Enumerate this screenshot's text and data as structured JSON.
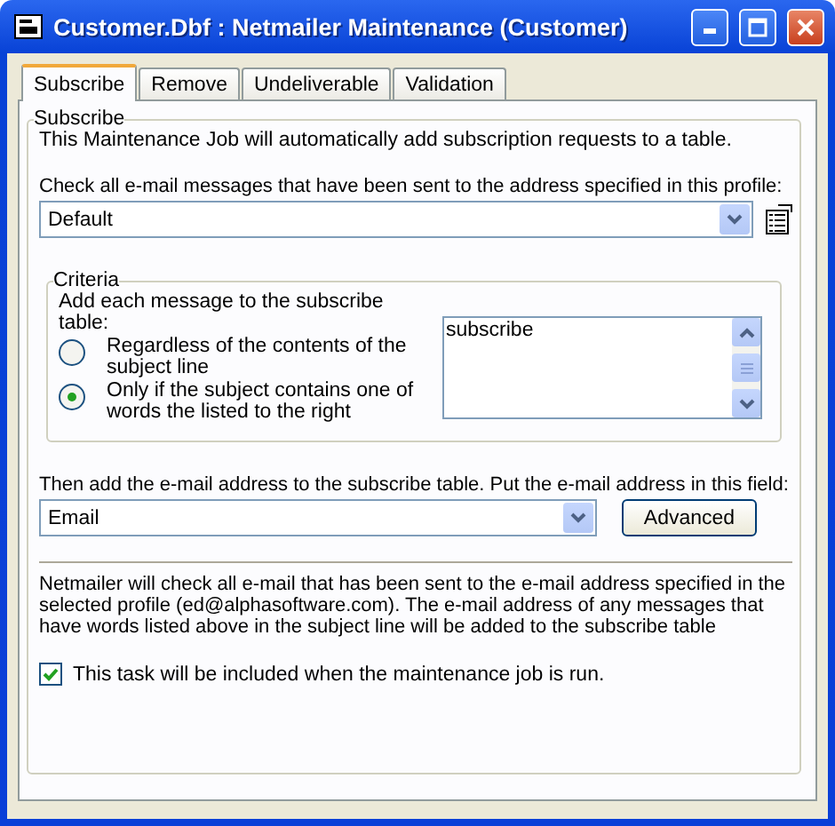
{
  "window": {
    "title": "Customer.Dbf : Netmailer Maintenance (Customer)"
  },
  "tabs": [
    {
      "label": "Subscribe",
      "selected": true
    },
    {
      "label": "Remove",
      "selected": false
    },
    {
      "label": "Undeliverable",
      "selected": false
    },
    {
      "label": "Validation",
      "selected": false
    }
  ],
  "group": {
    "title": "Subscribe"
  },
  "intro": "This Maintenance Job will automatically add subscription requests to a table.",
  "profile": {
    "label": "Check all e-mail messages that have been sent to the address specified in this profile:",
    "value": "Default"
  },
  "criteria": {
    "title": "Criteria",
    "prompt": "Add each message to the subscribe table:",
    "options": [
      {
        "label": "Regardless of the contents of the subject line",
        "selected": false
      },
      {
        "label": "Only if the subject contains one of words the listed to the right",
        "selected": true
      }
    ],
    "keywords": [
      "subscribe"
    ]
  },
  "field": {
    "label": "Then add the e-mail address to the subscribe table. Put the e-mail address in this field:",
    "value": "Email"
  },
  "advanced_button": "Advanced",
  "note": "Netmailer will check all e-mail that has been sent to the e-mail address specified in the selected profile (ed@alphasoftware.com). The e-mail address of any messages that have words listed above in the subject line will be added to the subscribe table",
  "include": {
    "label": "This task will be included when the maintenance job is run.",
    "checked": true
  }
}
